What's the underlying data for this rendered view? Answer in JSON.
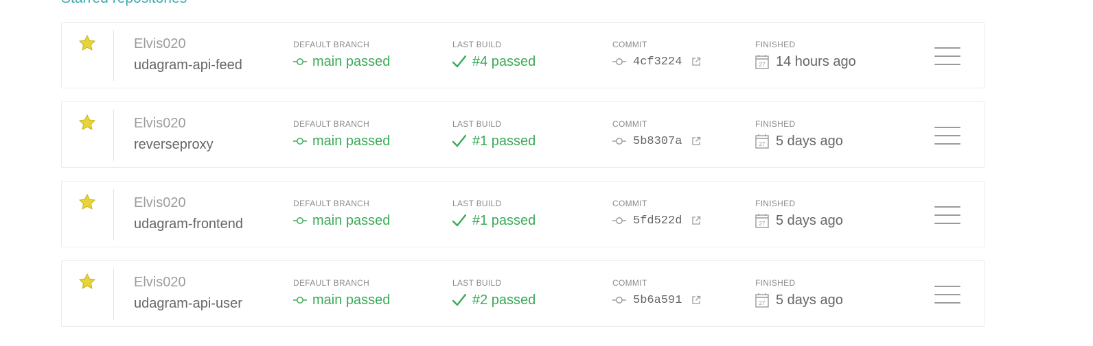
{
  "section_title": "Starred repositories",
  "labels": {
    "default_branch": "DEFAULT BRANCH",
    "last_build": "LAST BUILD",
    "commit": "COMMIT",
    "finished": "FINISHED"
  },
  "icons": {
    "star": "star-icon",
    "branch": "commit-node-icon",
    "check": "check-icon",
    "external": "external-link-icon",
    "calendar": "calendar-icon",
    "menu": "hamburger-menu-icon"
  },
  "calendar_day": "27",
  "colors": {
    "passed": "#39aa56",
    "star": "#e8d43a",
    "section_title": "#3eaaaf"
  },
  "repos": [
    {
      "owner": "Elvis020",
      "name": "udagram-api-feed",
      "branch": "main passed",
      "build": "#4 passed",
      "commit": "4cf3224",
      "finished": "14 hours ago"
    },
    {
      "owner": "Elvis020",
      "name": "reverseproxy",
      "branch": "main passed",
      "build": "#1 passed",
      "commit": "5b8307a",
      "finished": "5 days ago"
    },
    {
      "owner": "Elvis020",
      "name": "udagram-frontend",
      "branch": "main passed",
      "build": "#1 passed",
      "commit": "5fd522d",
      "finished": "5 days ago"
    },
    {
      "owner": "Elvis020",
      "name": "udagram-api-user",
      "branch": "main passed",
      "build": "#2 passed",
      "commit": "5b6a591",
      "finished": "5 days ago"
    }
  ]
}
